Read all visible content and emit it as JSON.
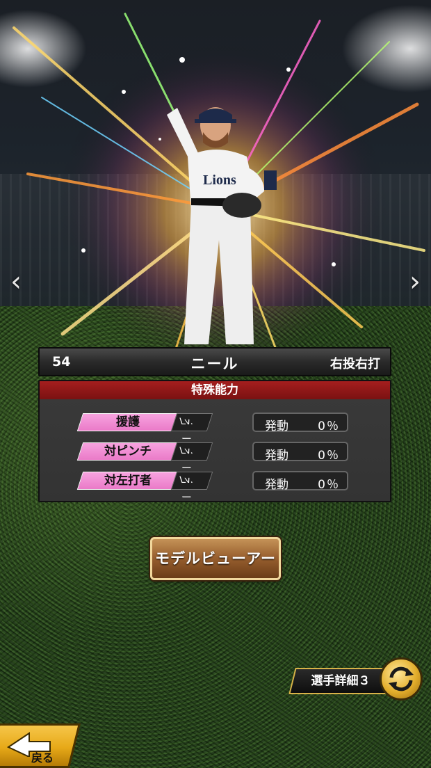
{
  "nav": {
    "prev_glyph": "‹",
    "next_glyph": "›"
  },
  "player": {
    "number": "54",
    "name": "ニール",
    "handedness": "右投右打"
  },
  "abilities": {
    "header": "特殊能力",
    "rows": [
      {
        "name": "援護",
        "level_label": "Lv.",
        "level_value": "ー",
        "activation_label": "発動",
        "activation_rate": "0％"
      },
      {
        "name": "対ピンチ",
        "level_label": "Lv.",
        "level_value": "ー",
        "activation_label": "発動",
        "activation_rate": "0％"
      },
      {
        "name": "対左打者",
        "level_label": "Lv.",
        "level_value": "ー",
        "activation_label": "発動",
        "activation_rate": "0％"
      }
    ]
  },
  "buttons": {
    "model_viewer": "モデルビューアー",
    "player_detail": "選手詳細３",
    "back": "戻る"
  },
  "colors": {
    "ability_badge": "#ea7ac8",
    "header_red": "#8e1515",
    "gold": "#e3ae2c"
  }
}
